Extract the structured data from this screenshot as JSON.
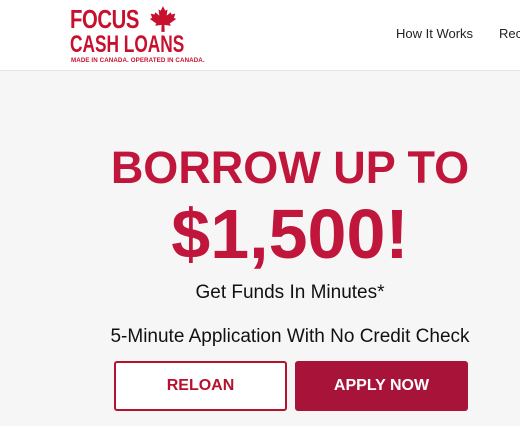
{
  "header": {
    "logo": {
      "line1": "FOCUS",
      "line2": "CASH LOANS",
      "tagline": "MADE IN CANADA. OPERATED IN CANADA.",
      "icon": "maple-leaf-icon",
      "color": "#c8102e"
    },
    "nav": {
      "how_it_works": "How It Works",
      "clipped_item": "Rec"
    }
  },
  "hero": {
    "title": "BORROW UP TO",
    "amount": "$1,500!",
    "subtitle": "Get Funds In Minutes*",
    "note": "5-Minute Application With No Credit Check",
    "accent_color": "#c0163b"
  },
  "buttons": {
    "reload": "RELOAN",
    "apply": "APPLY NOW"
  }
}
